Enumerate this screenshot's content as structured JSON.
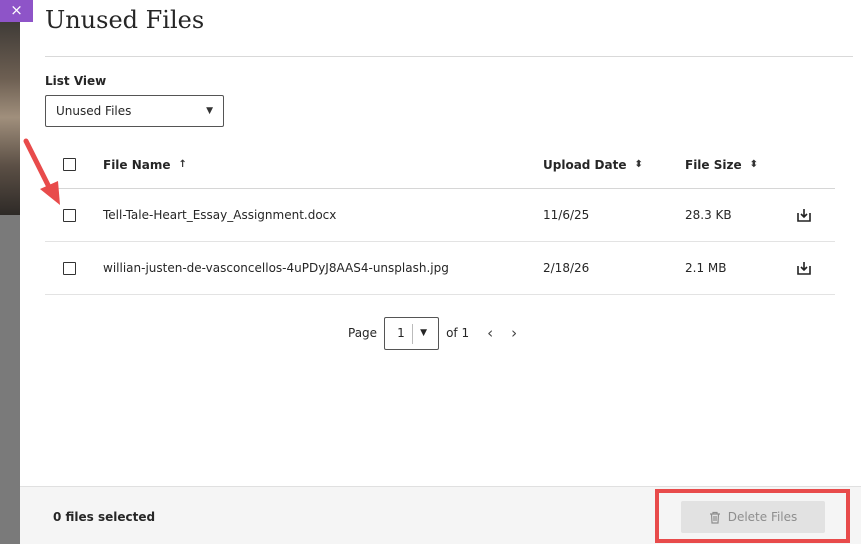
{
  "dialog": {
    "title": "Unused Files",
    "close_label": "×"
  },
  "list_view": {
    "label": "List View",
    "selected": "Unused Files"
  },
  "table": {
    "columns": {
      "file_name": "File Name",
      "upload_date": "Upload Date",
      "file_size": "File Size"
    },
    "rows": [
      {
        "name": "Tell-Tale-Heart_Essay_Assignment.docx",
        "upload_date": "11/6/25",
        "size": "28.3 KB"
      },
      {
        "name": "willian-justen-de-vasconcellos-4uPDyJ8AAS4-unsplash.jpg",
        "upload_date": "2/18/26",
        "size": "2.1 MB"
      }
    ]
  },
  "pagination": {
    "page_label": "Page",
    "current_page": "1",
    "of_label": "of 1"
  },
  "footer": {
    "selected_count": "0 files selected",
    "delete_label": "Delete Files"
  },
  "colors": {
    "accent_purple": "#8e54c8",
    "annotation_red": "#e84b4b",
    "disabled_button": "#e2e2e2"
  }
}
